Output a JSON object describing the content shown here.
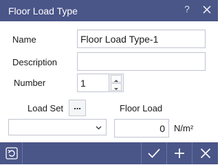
{
  "window": {
    "title": "Floor Load Type",
    "help_glyph": "?"
  },
  "form": {
    "name_label": "Name",
    "name_value": "Floor Load Type-1",
    "description_label": "Description",
    "description_value": "",
    "number_label": "Number",
    "number_value": "1",
    "load_set_label": "Load Set",
    "load_set_button": "...",
    "load_set_selected": "",
    "floor_load_label": "Floor Load",
    "floor_load_value": "0",
    "floor_load_unit": "N/m²"
  },
  "footer": {
    "icons": [
      "reset-icon",
      "checkmark-icon",
      "plus-icon",
      "close-icon"
    ]
  },
  "colors": {
    "titlebar": "#4a5588",
    "footer": "#4a5588",
    "input_border": "#bfc4d0"
  }
}
